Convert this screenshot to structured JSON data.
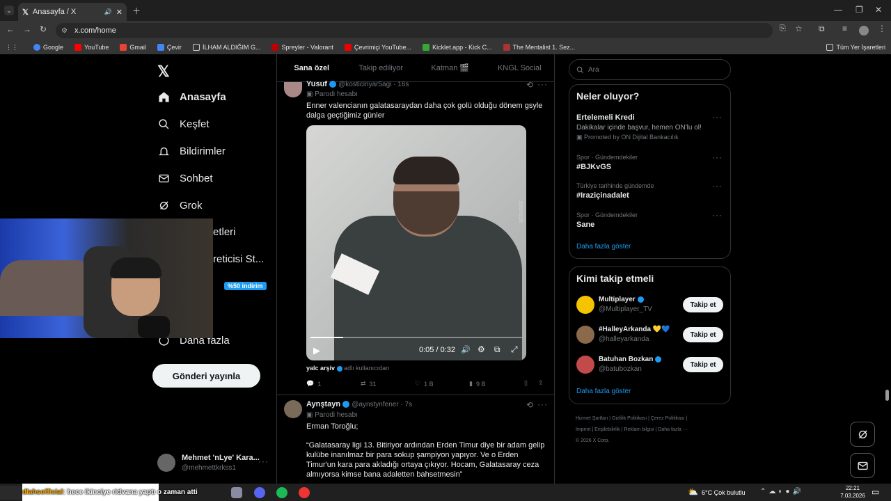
{
  "browser": {
    "tab_title": "Anasayfa / X",
    "url": "x.com/home",
    "bookmarks": [
      "Google",
      "YouTube",
      "Gmail",
      "Çevir",
      "İLHAM ALDIĞIM G...",
      "Spreyler - Valorant",
      "Çevrimiçi YouTube...",
      "Kicklet.app - Kick C...",
      "The Mentalist 1. Sez..."
    ],
    "all_bookmarks": "Tüm Yer İşaretleri"
  },
  "sidebar": {
    "items": [
      {
        "label": "Anasayfa"
      },
      {
        "label": "Keşfet"
      },
      {
        "label": "Bildirimler"
      },
      {
        "label": "Sohbet"
      },
      {
        "label": "Grok"
      },
      {
        "label": "etleri"
      },
      {
        "label": "reticisi St..."
      },
      {
        "label": "Daha fazla"
      }
    ],
    "discount": "%50 indirim",
    "post_button": "Gönderi yayınla",
    "account": {
      "name": "Mehmet 'nLye' Kara...",
      "handle": "@mehmettkrkss1"
    }
  },
  "feed": {
    "tabs": [
      "Sana özel",
      "Takip ediliyor",
      "Katman 🎬",
      "KNGL Social"
    ],
    "post1": {
      "name": "Yusuf",
      "handle": "@kosticinyar5agi · 16s",
      "tag": "Parodi hesabı",
      "text": "Enner valencianın galatasaraydan daha çok golü olduğu dönem gsyle dalga geçtiğimiz günler",
      "video_time": "0:05 / 0:32",
      "progress": 0.156,
      "source_name": "yalc arşiv",
      "source_suffix": "adlı kullanıcıdan",
      "watermark": "ahtvnelr",
      "replies": "1",
      "reposts": "31",
      "likes": "1 B",
      "views": "9 B"
    },
    "post2": {
      "name": "Aynştayn",
      "handle": "@aynstynfener · 7s",
      "tag": "Parodi hesabı",
      "line1": "Erman Toroğlu;",
      "line2": "“Galatasaray ligi 13. Bitiriyor ardından Erden Timur diye bir adam gelip kulübe inanılmaz bir para sokup şampiyon yapıyor. Ve o Erden Timur'un kara para akladığı ortaya çıkıyor. Hocam, Galatasaray ceza almıyorsa kimse bana adaletten bahsetmesin”"
    }
  },
  "right": {
    "search_placeholder": "Ara",
    "trends_title": "Neler oluyor?",
    "promo": {
      "title": "Ertelemeli Kredi",
      "desc": "Dakikalar içinde başvur, hemen ON'lu ol!",
      "promoted": "Promoted by ON Dijital Bankacılık"
    },
    "trends": [
      {
        "meta": "Spor · Gündemdekiler",
        "name": "#BJKvGS"
      },
      {
        "meta": "Türkiye tarihinde gündemde",
        "name": "#Iraziçinadalet"
      },
      {
        "meta": "Spor · Gündemdekiler",
        "name": "Sane"
      }
    ],
    "show_more": "Daha fazla göster",
    "who_title": "Kimi takip etmeli",
    "suggestions": [
      {
        "name": "Multiplayer",
        "handle": "@Multiplayer_TV",
        "button": "Takip et"
      },
      {
        "name": "#HalleyArkanda 💛💙",
        "handle": "@halleyarkanda",
        "button": "Takip et"
      },
      {
        "name": "Batuhan Bozkan",
        "handle": "@batubozkan",
        "button": "Takip et"
      }
    ],
    "show_more2": "Daha fazla göster",
    "footer": [
      "Hizmet Şartları",
      "Gizlilik Politikası",
      "Çerez Politikası",
      "Imprint",
      "Erişilebilirlik",
      "Reklam bilgisi",
      "Daha fazla ···",
      "© 2026 X Corp."
    ]
  },
  "taskbar": {
    "ticker": "hece ikinciye ridvana yaptı o zaman atti",
    "ticker_user": "dlahsofficial",
    "weather": "6°C  Çok bulutlu",
    "time": "22:21",
    "date": "7.03.2026"
  },
  "colors": {
    "accent": "#1d9bf0",
    "background": "#000000"
  }
}
